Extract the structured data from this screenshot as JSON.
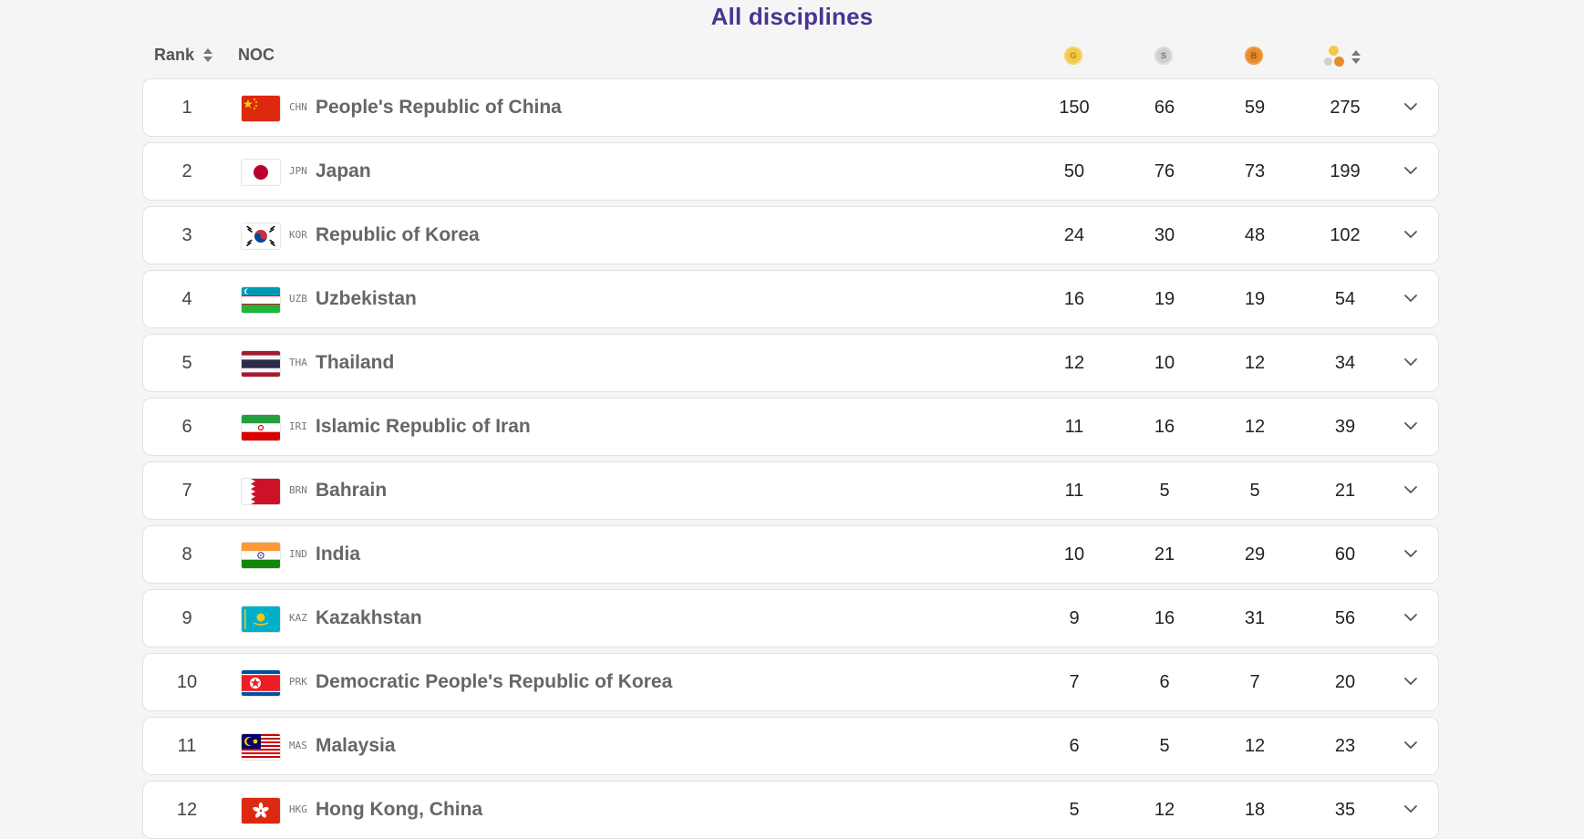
{
  "title": "All disciplines",
  "header": {
    "rank_label": "Rank",
    "noc_label": "NOC",
    "gold_letter": "G",
    "silver_letter": "S",
    "bronze_letter": "B"
  },
  "colors": {
    "title": "#4a3490",
    "gold": "#f2c94c",
    "silver": "#cfcfcf",
    "bronze": "#e58b2b"
  },
  "rows": [
    {
      "rank": "1",
      "code": "CHN",
      "name": "People's Republic of China",
      "gold": "150",
      "silver": "66",
      "bronze": "59",
      "total": "275",
      "flag": "china"
    },
    {
      "rank": "2",
      "code": "JPN",
      "name": "Japan",
      "gold": "50",
      "silver": "76",
      "bronze": "73",
      "total": "199",
      "flag": "japan"
    },
    {
      "rank": "3",
      "code": "KOR",
      "name": "Republic of Korea",
      "gold": "24",
      "silver": "30",
      "bronze": "48",
      "total": "102",
      "flag": "korea"
    },
    {
      "rank": "4",
      "code": "UZB",
      "name": "Uzbekistan",
      "gold": "16",
      "silver": "19",
      "bronze": "19",
      "total": "54",
      "flag": "uzbekistan"
    },
    {
      "rank": "5",
      "code": "THA",
      "name": "Thailand",
      "gold": "12",
      "silver": "10",
      "bronze": "12",
      "total": "34",
      "flag": "thailand"
    },
    {
      "rank": "6",
      "code": "IRI",
      "name": "Islamic Republic of Iran",
      "gold": "11",
      "silver": "16",
      "bronze": "12",
      "total": "39",
      "flag": "iran"
    },
    {
      "rank": "7",
      "code": "BRN",
      "name": "Bahrain",
      "gold": "11",
      "silver": "5",
      "bronze": "5",
      "total": "21",
      "flag": "bahrain"
    },
    {
      "rank": "8",
      "code": "IND",
      "name": "India",
      "gold": "10",
      "silver": "21",
      "bronze": "29",
      "total": "60",
      "flag": "india"
    },
    {
      "rank": "9",
      "code": "KAZ",
      "name": "Kazakhstan",
      "gold": "9",
      "silver": "16",
      "bronze": "31",
      "total": "56",
      "flag": "kazakhstan"
    },
    {
      "rank": "10",
      "code": "PRK",
      "name": "Democratic People's Republic of Korea",
      "gold": "7",
      "silver": "6",
      "bronze": "7",
      "total": "20",
      "flag": "dprk"
    },
    {
      "rank": "11",
      "code": "MAS",
      "name": "Malaysia",
      "gold": "6",
      "silver": "5",
      "bronze": "12",
      "total": "23",
      "flag": "malaysia"
    },
    {
      "rank": "12",
      "code": "HKG",
      "name": "Hong Kong, China",
      "gold": "5",
      "silver": "12",
      "bronze": "18",
      "total": "35",
      "flag": "hongkong"
    }
  ]
}
